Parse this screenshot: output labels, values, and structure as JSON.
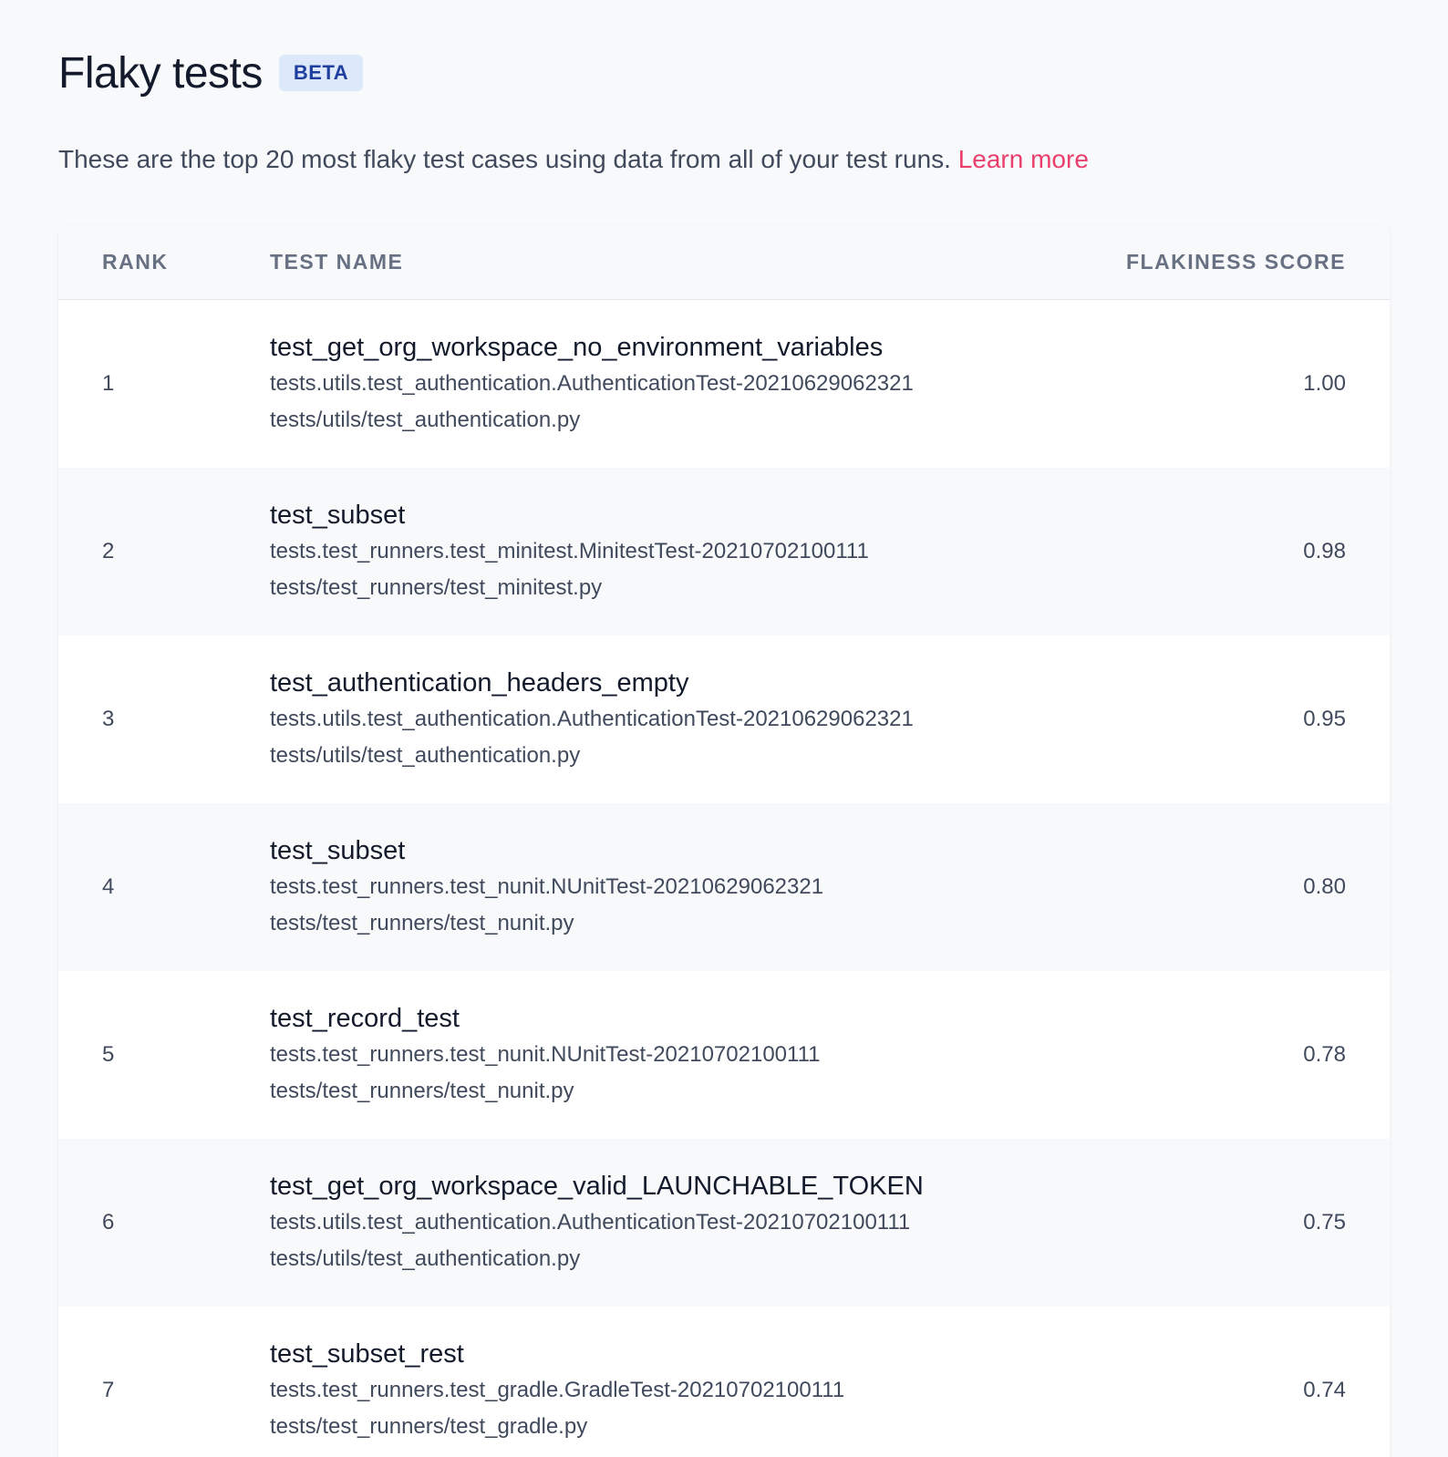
{
  "header": {
    "title": "Flaky tests",
    "badge": "BETA"
  },
  "description": {
    "text": "These are the top 20 most flaky test cases using data from all of your test runs. ",
    "link_label": "Learn more"
  },
  "table": {
    "columns": {
      "rank": "RANK",
      "test_name": "TEST NAME",
      "score": "FLAKINESS SCORE"
    },
    "rows": [
      {
        "rank": "1",
        "name": "test_get_org_workspace_no_environment_variables",
        "class": "tests.utils.test_authentication.AuthenticationTest-20210629062321",
        "file": "tests/utils/test_authentication.py",
        "score": "1.00"
      },
      {
        "rank": "2",
        "name": "test_subset",
        "class": "tests.test_runners.test_minitest.MinitestTest-20210702100111",
        "file": "tests/test_runners/test_minitest.py",
        "score": "0.98"
      },
      {
        "rank": "3",
        "name": "test_authentication_headers_empty",
        "class": "tests.utils.test_authentication.AuthenticationTest-20210629062321",
        "file": "tests/utils/test_authentication.py",
        "score": "0.95"
      },
      {
        "rank": "4",
        "name": "test_subset",
        "class": "tests.test_runners.test_nunit.NUnitTest-20210629062321",
        "file": "tests/test_runners/test_nunit.py",
        "score": "0.80"
      },
      {
        "rank": "5",
        "name": "test_record_test",
        "class": "tests.test_runners.test_nunit.NUnitTest-20210702100111",
        "file": "tests/test_runners/test_nunit.py",
        "score": "0.78"
      },
      {
        "rank": "6",
        "name": "test_get_org_workspace_valid_LAUNCHABLE_TOKEN",
        "class": "tests.utils.test_authentication.AuthenticationTest-20210702100111",
        "file": "tests/utils/test_authentication.py",
        "score": "0.75"
      },
      {
        "rank": "7",
        "name": "test_subset_rest",
        "class": "tests.test_runners.test_gradle.GradleTest-20210702100111",
        "file": "tests/test_runners/test_gradle.py",
        "score": "0.74"
      }
    ]
  },
  "colors": {
    "background": "#f8f9fb",
    "accent_link": "#ea3f6d",
    "badge_bg": "#dde8fb",
    "badge_text": "#1f3f9e"
  }
}
